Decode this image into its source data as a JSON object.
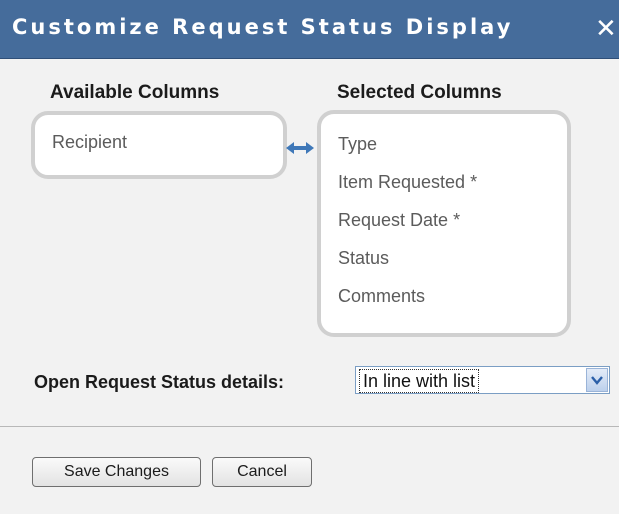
{
  "dialog": {
    "title": "Customize Request Status Display",
    "close_glyph": "✕",
    "close_icon": "close-icon"
  },
  "available": {
    "heading": "Available Columns",
    "items": [
      "Recipient"
    ]
  },
  "selected": {
    "heading": "Selected Columns",
    "items": [
      "Type",
      "Item Requested *",
      "Request Date *",
      "Status",
      "Comments"
    ]
  },
  "transfer": {
    "icon": "double-arrow-icon",
    "color": "#3f78b8"
  },
  "details": {
    "label": "Open Request Status details:",
    "selected_value": "In line with list"
  },
  "buttons": {
    "save": "Save Changes",
    "cancel": "Cancel"
  },
  "colors": {
    "titlebar": "#456c9b",
    "background": "#f2f2f2",
    "list_border": "#d0d0d0"
  }
}
